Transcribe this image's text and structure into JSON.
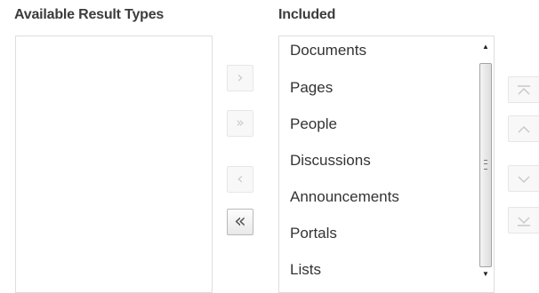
{
  "available": {
    "heading": "Available Result Types",
    "items": []
  },
  "included": {
    "heading": "Included",
    "items": [
      "Documents",
      "Pages",
      "People",
      "Discussions",
      "Announcements",
      "Portals",
      "Lists"
    ]
  },
  "shuttle_buttons": {
    "move": {
      "glyph": "›",
      "icon": "chevron-right-icon",
      "enabled": false
    },
    "move_all": {
      "glyph": "»",
      "icon": "double-chevron-right-icon",
      "enabled": false
    },
    "remove": {
      "glyph": "‹",
      "icon": "chevron-left-icon",
      "enabled": false
    },
    "remove_all": {
      "glyph": "«",
      "icon": "double-chevron-left-icon",
      "enabled": true
    }
  },
  "reorder_buttons": {
    "top": {
      "icon": "move-to-top-icon",
      "enabled": false
    },
    "up": {
      "icon": "move-up-icon",
      "enabled": false
    },
    "down": {
      "icon": "move-down-icon",
      "enabled": false
    },
    "bottom": {
      "icon": "move-to-bottom-icon",
      "enabled": false
    }
  },
  "colors": {
    "heading": "#3c3c3c",
    "item_text": "#333333",
    "border": "#dedede",
    "disabled_glyph": "#c9c9c9",
    "enabled_glyph": "#555555"
  }
}
